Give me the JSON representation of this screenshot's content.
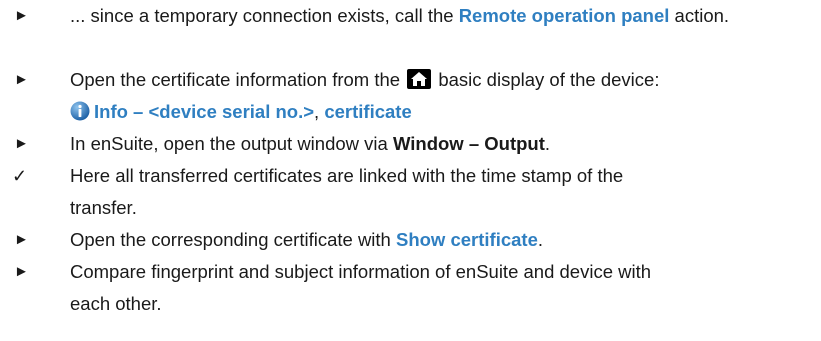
{
  "steps": [
    {
      "type": "action",
      "marker": "►",
      "pre": "... since a temporary connection exists, call the ",
      "link": "Remote operation panel",
      "post": " action."
    },
    {
      "type": "action",
      "marker": "►",
      "pre": "Open the certificate information from the ",
      "icon": "home-icon",
      "post": " basic display of the device:",
      "line2_icon": "info-icon",
      "line2_bold": "Info – <device serial no.>",
      "line2_sep": ", ",
      "line2_link": "certificate"
    },
    {
      "type": "action",
      "marker": "►",
      "pre": "In enSuite, open the output window via ",
      "bold": "Window – Output",
      "post": "."
    },
    {
      "type": "result",
      "marker": "✓",
      "text_line1": "Here all transferred certificates are linked with the time stamp of the",
      "text_line2": "transfer."
    },
    {
      "type": "action",
      "marker": "►",
      "pre": "Open the corresponding certificate with ",
      "link": "Show certificate",
      "post": "."
    },
    {
      "type": "action",
      "marker": "►",
      "text_line1": "Compare fingerprint and subject information of enSuite and device with",
      "text_line2": "each other."
    }
  ],
  "colors": {
    "link": "#2f7fc1",
    "text": "#1a1a1a",
    "info_icon": "#2f7fc1"
  }
}
